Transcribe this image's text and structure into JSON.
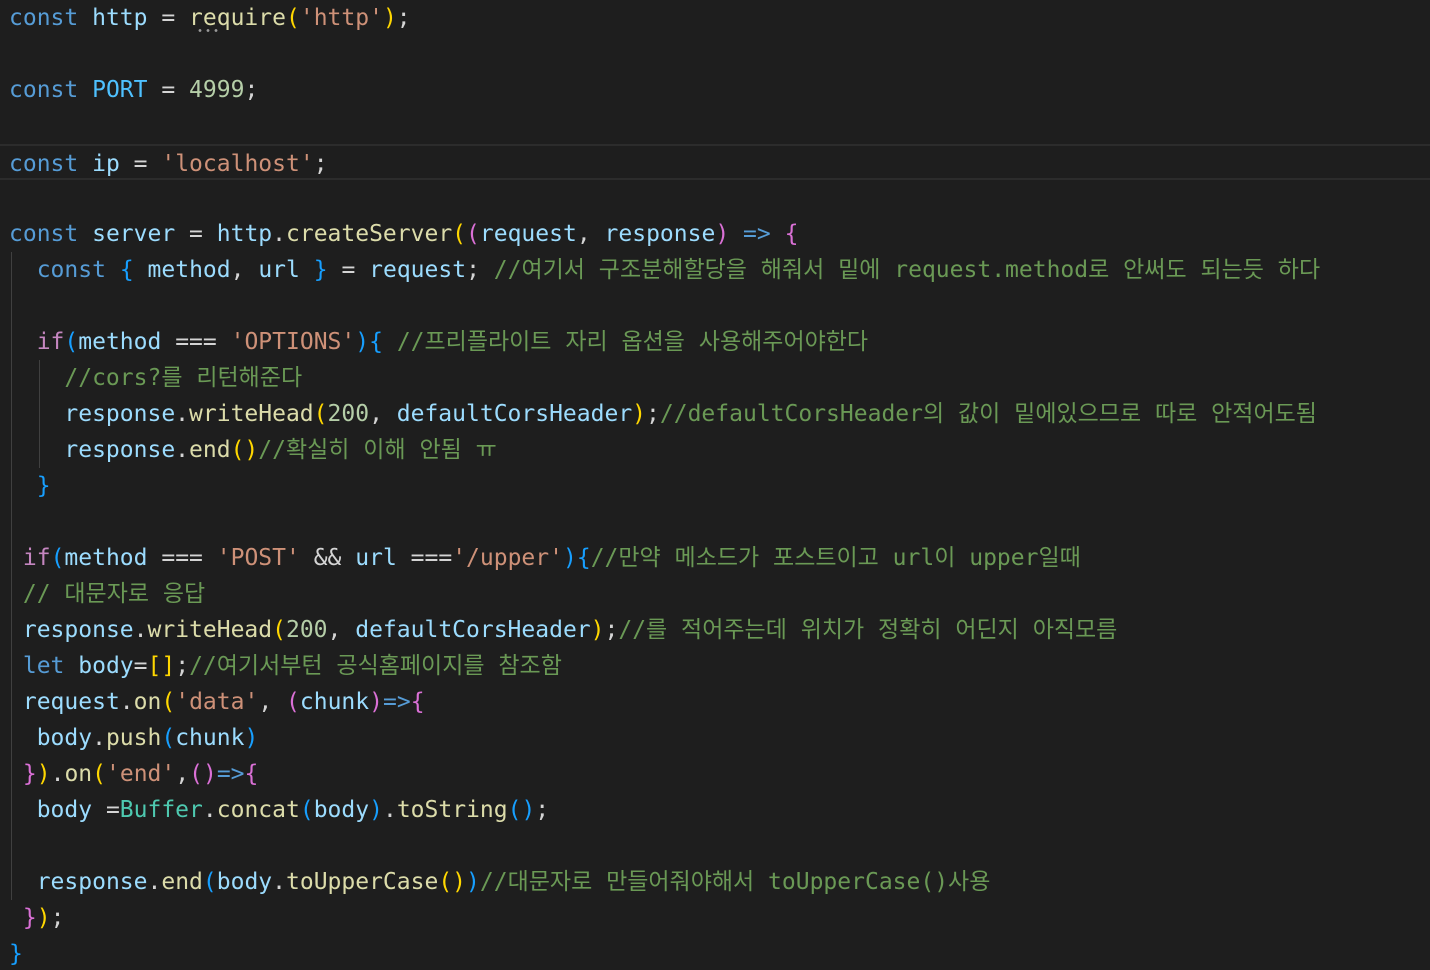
{
  "editor": {
    "language": "javascript",
    "theme_colors": {
      "background": "#1e1e1e",
      "keyword": "#569cd6",
      "control": "#c586c0",
      "variable": "#9cdcfe",
      "constant": "#4fc1ff",
      "function": "#dcdcaa",
      "string": "#ce9178",
      "number": "#b5cea8",
      "comment": "#6a9955",
      "class": "#4ec9b0"
    },
    "lines": [
      [
        [
          "kw",
          "const"
        ],
        [
          "op",
          " "
        ],
        [
          "var",
          "http"
        ],
        [
          "op",
          " = "
        ],
        [
          "fn",
          "require"
        ],
        [
          "b1",
          "("
        ],
        [
          "str",
          "'http'"
        ],
        [
          "b1",
          ")"
        ],
        [
          "op",
          ";"
        ]
      ],
      [],
      [
        [
          "kw",
          "const"
        ],
        [
          "op",
          " "
        ],
        [
          "cst",
          "PORT"
        ],
        [
          "op",
          " = "
        ],
        [
          "num",
          "4999"
        ],
        [
          "op",
          ";"
        ]
      ],
      [],
      [
        [
          "kw",
          "const"
        ],
        [
          "op",
          " "
        ],
        [
          "var",
          "ip"
        ],
        [
          "op",
          " = "
        ],
        [
          "str",
          "'localhost'"
        ],
        [
          "op",
          ";"
        ]
      ],
      [],
      [
        [
          "kw",
          "const"
        ],
        [
          "op",
          " "
        ],
        [
          "var",
          "server"
        ],
        [
          "op",
          " = "
        ],
        [
          "var",
          "http"
        ],
        [
          "op",
          "."
        ],
        [
          "fn",
          "createServer"
        ],
        [
          "b1",
          "("
        ],
        [
          "b2",
          "("
        ],
        [
          "var",
          "request"
        ],
        [
          "op",
          ", "
        ],
        [
          "var",
          "response"
        ],
        [
          "b2",
          ")"
        ],
        [
          "op",
          " "
        ],
        [
          "kw",
          "=>"
        ],
        [
          "op",
          " "
        ],
        [
          "b2",
          "{"
        ]
      ],
      [
        [
          "op",
          "  "
        ],
        [
          "kw",
          "const"
        ],
        [
          "op",
          " "
        ],
        [
          "b3",
          "{"
        ],
        [
          "op",
          " "
        ],
        [
          "var",
          "method"
        ],
        [
          "op",
          ", "
        ],
        [
          "var",
          "url"
        ],
        [
          "op",
          " "
        ],
        [
          "b3",
          "}"
        ],
        [
          "op",
          " = "
        ],
        [
          "var",
          "request"
        ],
        [
          "op",
          "; "
        ],
        [
          "cmt",
          "//여기서 구조분해할당을 해줘서 밑에 request.method로 안써도 되는듯 하다"
        ]
      ],
      [],
      [
        [
          "op",
          "  "
        ],
        [
          "ctrl",
          "if"
        ],
        [
          "b3",
          "("
        ],
        [
          "var",
          "method"
        ],
        [
          "op",
          " === "
        ],
        [
          "str",
          "'OPTIONS'"
        ],
        [
          "b3",
          ")"
        ],
        [
          "b3",
          "{"
        ],
        [
          "op",
          " "
        ],
        [
          "cmt",
          "//프리플라이트 자리 옵션을 사용해주어야한다"
        ]
      ],
      [
        [
          "op",
          "    "
        ],
        [
          "cmt",
          "//cors?를 리턴해준다"
        ]
      ],
      [
        [
          "op",
          "    "
        ],
        [
          "var",
          "response"
        ],
        [
          "op",
          "."
        ],
        [
          "fn",
          "writeHead"
        ],
        [
          "b1",
          "("
        ],
        [
          "num",
          "200"
        ],
        [
          "op",
          ", "
        ],
        [
          "var",
          "defaultCorsHeader"
        ],
        [
          "b1",
          ")"
        ],
        [
          "op",
          ";"
        ],
        [
          "cmt",
          "//defaultCorsHeader의 값이 밑에있으므로 따로 안적어도됨"
        ]
      ],
      [
        [
          "op",
          "    "
        ],
        [
          "var",
          "response"
        ],
        [
          "op",
          "."
        ],
        [
          "fn",
          "end"
        ],
        [
          "b1",
          "()"
        ],
        [
          "cmt",
          "//확실히 이해 안됨 ㅠ"
        ]
      ],
      [
        [
          "op",
          "  "
        ],
        [
          "b3",
          "}"
        ]
      ],
      [],
      [
        [
          "op",
          " "
        ],
        [
          "ctrl",
          "if"
        ],
        [
          "b3",
          "("
        ],
        [
          "var",
          "method"
        ],
        [
          "op",
          " === "
        ],
        [
          "str",
          "'POST'"
        ],
        [
          "op",
          " && "
        ],
        [
          "var",
          "url"
        ],
        [
          "op",
          " ==="
        ],
        [
          "str",
          "'/upper'"
        ],
        [
          "b3",
          ")"
        ],
        [
          "b3",
          "{"
        ],
        [
          "cmt",
          "//만약 메소드가 포스트이고 url이 upper일때"
        ]
      ],
      [
        [
          "op",
          " "
        ],
        [
          "cmt",
          "// 대문자로 응답"
        ]
      ],
      [
        [
          "op",
          " "
        ],
        [
          "var",
          "response"
        ],
        [
          "op",
          "."
        ],
        [
          "fn",
          "writeHead"
        ],
        [
          "b1",
          "("
        ],
        [
          "num",
          "200"
        ],
        [
          "op",
          ", "
        ],
        [
          "var",
          "defaultCorsHeader"
        ],
        [
          "b1",
          ")"
        ],
        [
          "op",
          ";"
        ],
        [
          "cmt",
          "//를 적어주는데 위치가 정확히 어딘지 아직모름"
        ]
      ],
      [
        [
          "op",
          " "
        ],
        [
          "kw",
          "let"
        ],
        [
          "op",
          " "
        ],
        [
          "var",
          "body"
        ],
        [
          "op",
          "="
        ],
        [
          "b1",
          "[]"
        ],
        [
          "op",
          ";"
        ],
        [
          "cmt",
          "//여기서부턴 공식홈페이지를 참조함"
        ]
      ],
      [
        [
          "op",
          " "
        ],
        [
          "var",
          "request"
        ],
        [
          "op",
          "."
        ],
        [
          "fn",
          "on"
        ],
        [
          "b1",
          "("
        ],
        [
          "str",
          "'data'"
        ],
        [
          "op",
          ", "
        ],
        [
          "b2",
          "("
        ],
        [
          "var",
          "chunk"
        ],
        [
          "b2",
          ")"
        ],
        [
          "kw",
          "=>"
        ],
        [
          "b2",
          "{"
        ]
      ],
      [
        [
          "op",
          "  "
        ],
        [
          "var",
          "body"
        ],
        [
          "op",
          "."
        ],
        [
          "fn",
          "push"
        ],
        [
          "b3",
          "("
        ],
        [
          "var",
          "chunk"
        ],
        [
          "b3",
          ")"
        ]
      ],
      [
        [
          "op",
          " "
        ],
        [
          "b2",
          "}"
        ],
        [
          "b1",
          ")"
        ],
        [
          "op",
          "."
        ],
        [
          "fn",
          "on"
        ],
        [
          "b1",
          "("
        ],
        [
          "str",
          "'end'"
        ],
        [
          "op",
          ","
        ],
        [
          "b2",
          "()"
        ],
        [
          "kw",
          "=>"
        ],
        [
          "b2",
          "{"
        ]
      ],
      [
        [
          "op",
          "  "
        ],
        [
          "var",
          "body"
        ],
        [
          "op",
          " ="
        ],
        [
          "cls",
          "Buffer"
        ],
        [
          "op",
          "."
        ],
        [
          "fn",
          "concat"
        ],
        [
          "b3",
          "("
        ],
        [
          "var",
          "body"
        ],
        [
          "b3",
          ")"
        ],
        [
          "op",
          "."
        ],
        [
          "fn",
          "toString"
        ],
        [
          "b3",
          "()"
        ],
        [
          "op",
          ";"
        ]
      ],
      [],
      [
        [
          "op",
          "  "
        ],
        [
          "var",
          "response"
        ],
        [
          "op",
          "."
        ],
        [
          "fn",
          "end"
        ],
        [
          "b3",
          "("
        ],
        [
          "var",
          "body"
        ],
        [
          "op",
          "."
        ],
        [
          "fn",
          "toUpperCase"
        ],
        [
          "b1",
          "()"
        ],
        [
          "b3",
          ")"
        ],
        [
          "cmt",
          "//대문자로 만들어줘야해서 toUpperCase()사용"
        ]
      ],
      [
        [
          "op",
          " "
        ],
        [
          "b2",
          "}"
        ],
        [
          "b1",
          ")"
        ],
        [
          "op",
          ";"
        ]
      ],
      [
        [
          "b3",
          "}"
        ]
      ]
    ]
  }
}
